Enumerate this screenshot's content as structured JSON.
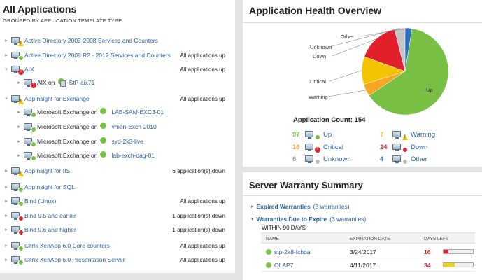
{
  "left": {
    "title": "All Applications",
    "subtitle": "GROUPED BY APPLICATION TEMPLATE TYPE",
    "rows": [
      {
        "label": "Active Directory 2003-2008 Services and Counters",
        "status": "",
        "badge": "warn",
        "level": 0
      },
      {
        "label": "Active Directory 2008 R2 - 2012 Services and Counters",
        "status": "All applications up",
        "badge": "up",
        "level": 0
      },
      {
        "label": "AIX",
        "status": "All applications up",
        "badge": "critical",
        "level": 0
      },
      {
        "label": "AIX on",
        "node": "StP-aix71",
        "status": "",
        "badge": "critical",
        "level": 1
      },
      {
        "label": "AppInsight for Exchange",
        "status": "All applications up",
        "badge": "warn",
        "level": 0
      },
      {
        "label": "Microsoft Exchange on",
        "node": "LAB-SAM-EXC3-01",
        "status": "",
        "badge": "up",
        "level": 1
      },
      {
        "label": "Microsoft Exchange on",
        "node": "vman-Exch-2010",
        "status": "",
        "badge": "up",
        "level": 1
      },
      {
        "label": "Microsoft Exchange on",
        "node": "syd-2k3-live",
        "status": "",
        "badge": "up",
        "level": 1
      },
      {
        "label": "Microsoft Exchange on",
        "node": "lab-exch-dag-01",
        "status": "",
        "badge": "up",
        "level": 1
      },
      {
        "label": "AppInsight for IIS",
        "status": "6 application(s) down",
        "badge": "warn",
        "level": 0
      },
      {
        "label": "AppInsight for SQL",
        "status": "",
        "badge": "up",
        "level": 0
      },
      {
        "label": "Bind (Linux)",
        "status": "All applications up",
        "badge": "up",
        "level": 0
      },
      {
        "label": "Bind 9.5 and earlier",
        "status": "1 application(s) down",
        "badge": "down",
        "level": 0
      },
      {
        "label": "Bind 9.6 and higher",
        "status": "1 application(s) down",
        "badge": "down",
        "level": 0
      },
      {
        "label": "Citrix XenApp 6.0 Core counters",
        "status": "All applications up",
        "badge": "up",
        "level": 0
      },
      {
        "label": "Citrix XenApp 6.0 Presentation Server",
        "status": "All applications up",
        "badge": "up",
        "level": 0
      }
    ]
  },
  "health": {
    "title": "Application Health Overview",
    "count_label": "Application Count: 154",
    "pie": {
      "type": "pie",
      "slices": [
        {
          "name": "Up",
          "value": 97,
          "color": "#77c043"
        },
        {
          "name": "Warning",
          "value": 7,
          "color": "#f6a623"
        },
        {
          "name": "Critical",
          "value": 16,
          "color": "#f5c400"
        },
        {
          "name": "Down",
          "value": 24,
          "color": "#e2202c"
        },
        {
          "name": "Unknown",
          "value": 6,
          "color": "#c4c4c4"
        },
        {
          "name": "Other",
          "value": 4,
          "color": "#2e6fc0"
        }
      ]
    },
    "legend": [
      {
        "n": "97",
        "label": "Up",
        "color": "#77c043",
        "badge": "up"
      },
      {
        "n": "7",
        "label": "Warning",
        "color": "#f2c100",
        "badge": "warn"
      },
      {
        "n": "16",
        "label": "Critical",
        "color": "#f6a623",
        "badge": "critical"
      },
      {
        "n": "24",
        "label": "Down",
        "color": "#d9282f",
        "badge": "down"
      },
      {
        "n": "6",
        "label": "Unknown",
        "color": "#999999",
        "badge": "unknown"
      },
      {
        "n": "4",
        "label": "Other",
        "color": "#2e6fc0",
        "badge": "other"
      }
    ]
  },
  "warranty": {
    "title": "Server Warranty Summary",
    "expired_label": "Expired Warranties",
    "expired_count": "(3 warranties)",
    "due_label": "Warranties Due to Expire",
    "due_count": "(3 warranties)",
    "within": "WITHIN 90 DAYS",
    "headers": {
      "name": "NAME",
      "date": "EXPIRATION DATE",
      "days": "DAYS LEFT"
    },
    "rows": [
      {
        "name": "stp-2k8-fchba",
        "date": "3/24/2017",
        "days": "16",
        "days_value": 16,
        "bar_color": "#d9282f"
      },
      {
        "name": "OLAP7",
        "date": "4/11/2017",
        "days": "34",
        "days_value": 34,
        "bar_color": "#f2d600"
      }
    ]
  }
}
